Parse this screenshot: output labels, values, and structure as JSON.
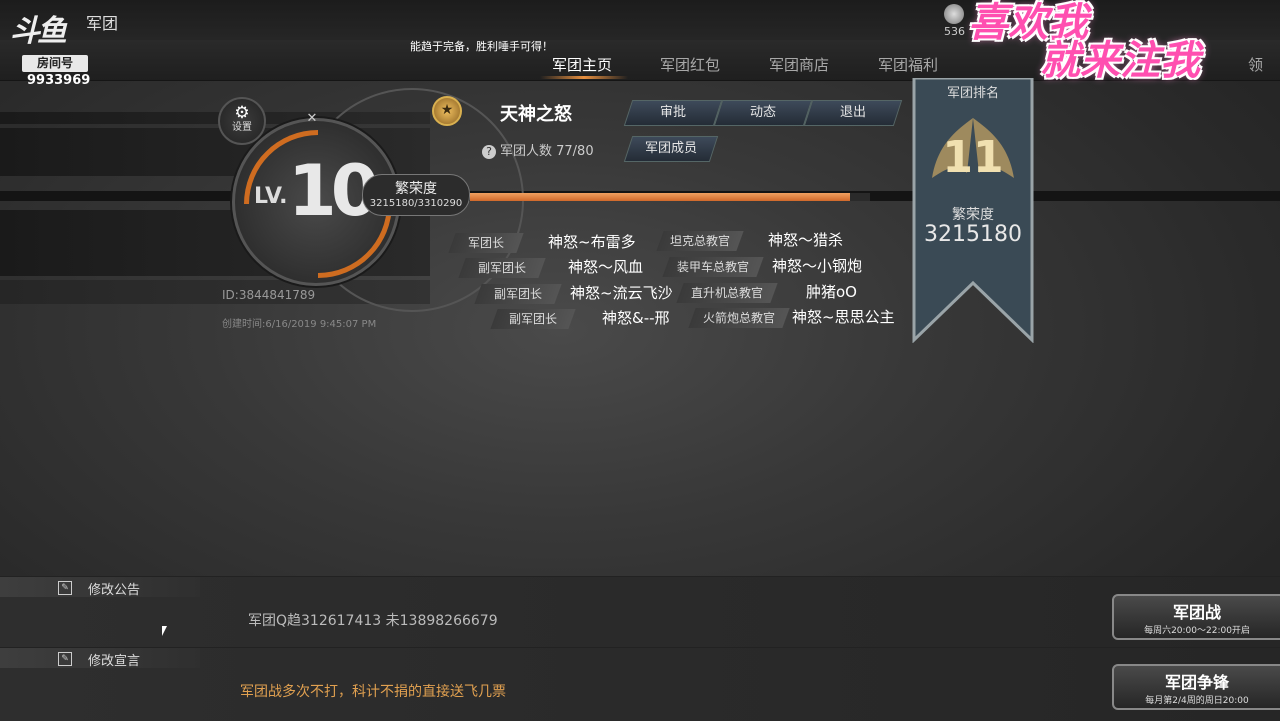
{
  "header": {
    "logo": "斗鱼",
    "room_label": "房间号",
    "room_no": "9933969",
    "title": "军团",
    "slogan": "能趋于完备，胜利唾手可得！",
    "coins": "536",
    "overlay_line1": "喜欢我",
    "overlay_line2": "就来注我"
  },
  "tabs": [
    {
      "label": "军团主页",
      "active": true
    },
    {
      "label": "军团红包",
      "active": false
    },
    {
      "label": "军团商店",
      "active": false
    },
    {
      "label": "军团福利",
      "active": false
    },
    {
      "label": "领",
      "active": false
    }
  ],
  "level": {
    "lv_label": "LV.",
    "lv_num": "10",
    "settings_label": "设置",
    "prosperity_label": "繁荣度",
    "prosperity_value": "3215180/3310290",
    "prosperity_fraction": 0.95,
    "id_text": "ID:3844841789",
    "created_text": "创建时间:6/16/2019 9:45:07 PM"
  },
  "guild": {
    "name": "天神之怒",
    "member_count": "军团人数 77/80",
    "buttons": {
      "approve": "审批",
      "news": "动态",
      "quit": "退出",
      "members": "军团成员"
    }
  },
  "officers": [
    {
      "role": "军团长",
      "name": "神怒~布雷多"
    },
    {
      "role": "副军团长",
      "name": "神怒～风血"
    },
    {
      "role": "副军团长",
      "name": "神怒~流云飞沙"
    },
    {
      "role": "副军团长",
      "name": "神怒&--邢"
    },
    {
      "role": "坦克总教官",
      "name": "神怒～猎杀"
    },
    {
      "role": "装甲车总教官",
      "name": "神怒～小钢炮"
    },
    {
      "role": "直升机总教官",
      "name": "肿猪oO"
    },
    {
      "role": "火箭炮总教官",
      "name": "神怒~思思公主"
    }
  ],
  "ranking": {
    "title": "军团排名",
    "rank": "11",
    "prosperity_label": "繁荣度",
    "prosperity_value": "3215180"
  },
  "bottom": {
    "notice_label": "修改公告",
    "notice_text": "军团Q趋312617413  未13898266679",
    "decl_label": "修改宣言",
    "decl_text": "军团战多次不打，科计不捐的直接送飞几票",
    "war_title": "军团战",
    "war_sub": "每周六20:00～22:00开启",
    "contest_title": "军团争锋",
    "contest_sub": "每月第2/4周的周日20:00"
  },
  "colors": {
    "accent": "#e0731f",
    "gold": "#d9b050"
  }
}
